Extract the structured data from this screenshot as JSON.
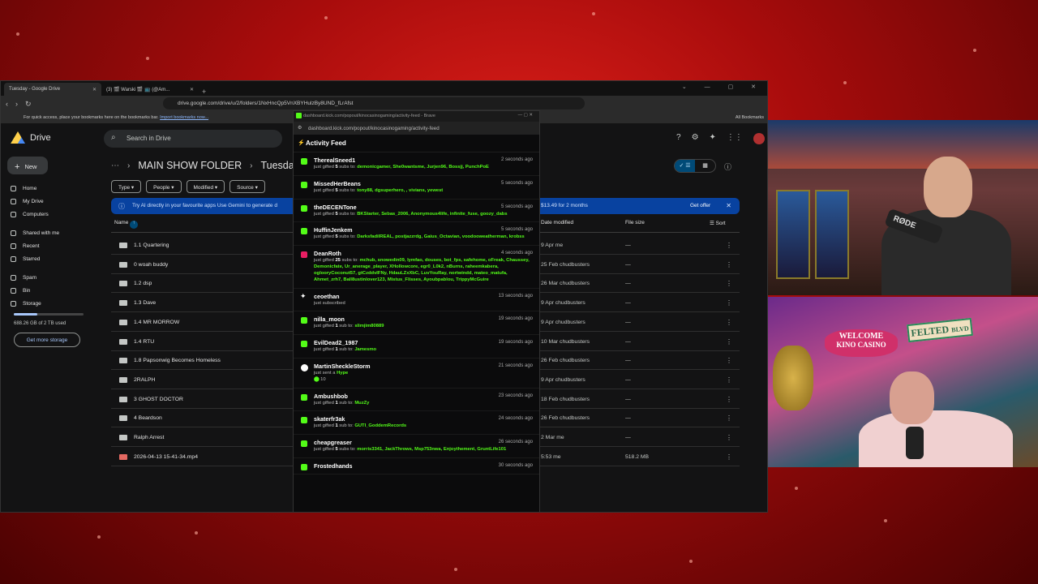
{
  "browser": {
    "tabs": [
      {
        "label": "Tuesday - Google Drive"
      },
      {
        "label": "(3) 🎬 Warski 🎬 📺 (@Am..."
      }
    ],
    "url": "drive.google.com/drive/u/2/folders/1NxHncQp5VnXBYHulzBy8UND_fLrAfst",
    "bookmarks_text": "For quick access, place your bookmarks here on the bookmarks bar.",
    "bookmarks_link": "Import bookmarks now...",
    "all_bookmarks": "All Bookmarks"
  },
  "drive": {
    "brand": "Drive",
    "search_placeholder": "Search in Drive",
    "new_label": "New",
    "nav": [
      "Home",
      "My Drive",
      "Computers",
      "Shared with me",
      "Recent",
      "Starred",
      "Spam",
      "Bin",
      "Storage"
    ],
    "storage_used": "688.26 GB of 2 TB used",
    "storage_fraction": 0.34,
    "get_storage": "Get more storage",
    "breadcrumb": {
      "parent": "MAIN SHOW FOLDER",
      "current": "Tuesday"
    },
    "filters": [
      "Type",
      "People",
      "Modified",
      "Source"
    ],
    "banner": {
      "text": "Try AI directly in your favourite apps Use Gemini to generate d",
      "price": "$13.49 for 2 months",
      "offer": "Get offer"
    },
    "columns": {
      "name": "Name",
      "date": "Date modified",
      "size": "File size",
      "sort": "Sort"
    },
    "files": [
      {
        "name": "1.1 Quartering",
        "date": "9 Apr me",
        "size": "—"
      },
      {
        "name": "0 woah buddy",
        "date": "25 Feb chudbusters",
        "size": "—"
      },
      {
        "name": "1.2 dsp",
        "date": "26 Mar chudbusters",
        "size": "—"
      },
      {
        "name": "1.3 Dave",
        "date": "9 Apr chudbusters",
        "size": "—"
      },
      {
        "name": "1.4 MR MORROW",
        "date": "9 Apr chudbusters",
        "size": "—"
      },
      {
        "name": "1.4 RTU",
        "date": "10 Mar chudbusters",
        "size": "—"
      },
      {
        "name": "1.8 Papsonwig Becomes Homeless",
        "date": "26 Feb chudbusters",
        "size": "—"
      },
      {
        "name": "2RALPH",
        "date": "9 Apr chudbusters",
        "size": "—"
      },
      {
        "name": "3 GHOST DOCTOR",
        "date": "18 Feb chudbusters",
        "size": "—"
      },
      {
        "name": "4 Beardson",
        "date": "26 Feb chudbusters",
        "size": "—"
      },
      {
        "name": "Ralph Arrest",
        "date": "2 Mar me",
        "size": "—"
      },
      {
        "name": "2026-04-13 15-41-34.mp4",
        "date": "5:53 me",
        "size": "518.2 MB"
      }
    ]
  },
  "feed": {
    "window_title": "dashboard.kick.com/popout/kinocasinogaming/activity-feed - Brave",
    "url": "dashboard.kick.com/popout/kinocasinogaming/activity-feed",
    "title": "Activity Feed",
    "events": [
      {
        "user": "TherealSneed1",
        "time": "2 seconds ago",
        "action": "just gifted",
        "count": "5",
        "suffix": "subs to:",
        "names": "demonicgamer, She0wantsme, Jurjen96, Bossjj, PunchPoE",
        "type": "gift"
      },
      {
        "user": "MissedHerBeans",
        "time": "5 seconds ago",
        "action": "just gifted",
        "count": "5",
        "suffix": "subs to:",
        "names": "tony88, dgsuperhero, , vivians, yewest",
        "type": "gift"
      },
      {
        "user": "theDECENTone",
        "time": "5 seconds ago",
        "action": "just gifted",
        "count": "5",
        "suffix": "subs to:",
        "names": "BKStarter, Sebas_2006, Anonymous4life, infinite_fuse, goozy_dabs",
        "type": "gift"
      },
      {
        "user": "HuffinJenkem",
        "time": "5 seconds ago",
        "action": "just gifted",
        "count": "5",
        "suffix": "subs to:",
        "names": "DarksfadilREAL, postjazzrdg, Gaius_Octavian, voodooweatherman, krobss",
        "type": "gift"
      },
      {
        "user": "DeanRoth",
        "time": "4 seconds ago",
        "action": "just gifted",
        "count": "25",
        "suffix": "subs to:",
        "names": "mchub, snowedin09, lymfao, douses, bot_fps, safehome, oFreak, Chaussey, Demonicfate, Ur_anerage_player, XHollowcore, egr0_L0k2, nBurns, raheemkabera, oglooryCoconut57, gtCzddvlFNy, HdauLZxXbC, LuvYouRay, nortwindd, mateo_matufa, Ahmet_zrh7, Ball8ustinlover123, Mistus_Flisses, Ayoubpablou, TrippyMcGuire",
        "type": "gift-pink"
      },
      {
        "user": "ceoethan",
        "time": "13 seconds ago",
        "action": "just subscribed",
        "count": "",
        "suffix": "",
        "names": "",
        "type": "sub"
      },
      {
        "user": "nilla_moon",
        "time": "19 seconds ago",
        "action": "just gifted",
        "count": "1",
        "suffix": "sub to:",
        "names": "slimjim80889",
        "type": "gift"
      },
      {
        "user": "EvilDead2_1987",
        "time": "19 seconds ago",
        "action": "just gifted",
        "count": "1",
        "suffix": "sub to:",
        "names": "Jamesmo",
        "type": "gift"
      },
      {
        "user": "MartinSheckleStorm",
        "time": "21 seconds ago",
        "action": "just sent a",
        "count": "",
        "suffix": "",
        "names": "Hype",
        "extra": "10",
        "type": "hype"
      },
      {
        "user": "Ambushbob",
        "time": "23 seconds ago",
        "action": "just gifted",
        "count": "1",
        "suffix": "sub to:",
        "names": "MuzZy",
        "type": "gift"
      },
      {
        "user": "skaterfr3ak",
        "time": "24 seconds ago",
        "action": "just gifted",
        "count": "1",
        "suffix": "sub to:",
        "names": "GUTI_GoddemRecords",
        "type": "gift"
      },
      {
        "user": "cheapgreaser",
        "time": "26 seconds ago",
        "action": "just gifted",
        "count": "5",
        "suffix": "subs to:",
        "names": "morris3341, JackThrows, Msp753nwa, Enjoythement, GruntLife101",
        "type": "gift"
      },
      {
        "user": "Frostedhands",
        "time": "30 seconds ago",
        "action": "",
        "count": "",
        "suffix": "",
        "names": "",
        "type": "gift"
      }
    ]
  },
  "overlay": {
    "sign_welcome": "WELCOME",
    "sign_kino": "KINO CASINO",
    "sign_felted": "FELTED",
    "sign_blvd": "BLVD",
    "mic_brand": "RØDE"
  }
}
